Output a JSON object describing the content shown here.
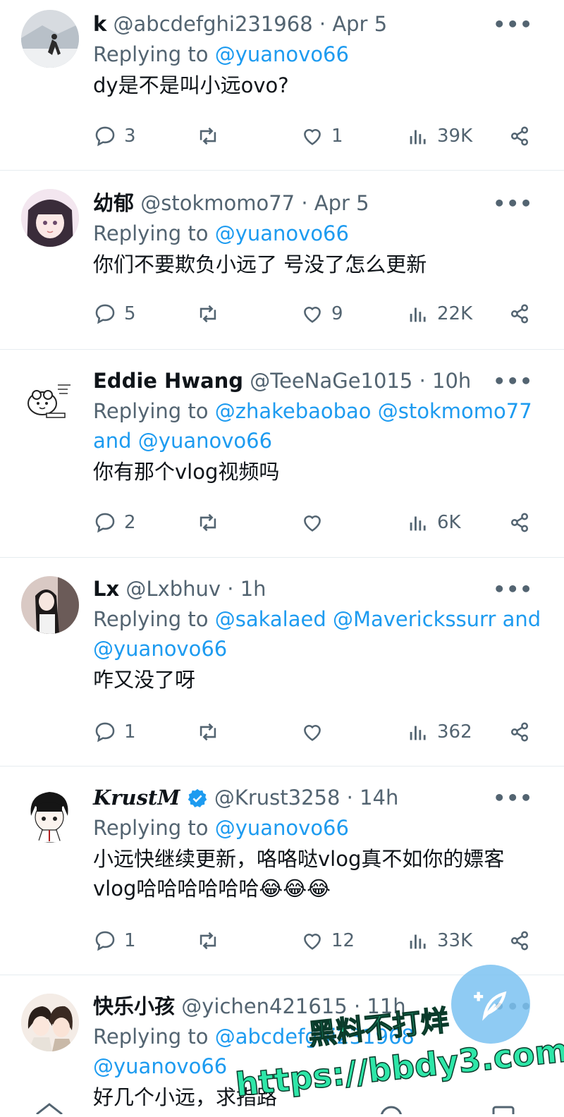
{
  "tweets": [
    {
      "name": "k",
      "handle": "@abcdefghi231968",
      "time": "Apr 5",
      "reply_prefix": "Replying to ",
      "reply_to": "@yuanovo66",
      "text": "dy是不是叫小远ovo?",
      "replies": "3",
      "likes": "1",
      "views": "39K"
    },
    {
      "name": "幼郁",
      "handle": "@stokmomo77",
      "time": "Apr 5",
      "reply_prefix": "Replying to ",
      "reply_to": "@yuanovo66",
      "text": "你们不要欺负小远了 号没了怎么更新",
      "replies": "5",
      "likes": "9",
      "views": "22K"
    },
    {
      "name": "Eddie Hwang",
      "handle": "@TeeNaGe1015",
      "time": "10h",
      "reply_prefix": "Replying to ",
      "reply_to": "@zhakebaobao @stokmomo77",
      "reply_and": "and ",
      "reply_to2": "@yuanovo66",
      "text": "你有那个vlog视频吗",
      "replies": "2",
      "likes": "",
      "views": "6K"
    },
    {
      "name": "Lx",
      "handle": "@Lxbhuv",
      "time": "1h",
      "reply_prefix": "Replying to ",
      "reply_to": "@sakalaed @Maverickssurr",
      "reply_and": " and",
      "reply_to2": "@yuanovo66",
      "text": "咋又没了呀",
      "replies": "1",
      "likes": "",
      "views": "362"
    },
    {
      "name": "KrustM",
      "handle": "@Krust3258",
      "time": "14h",
      "reply_prefix": "Replying to ",
      "reply_to": "@yuanovo66",
      "text": "小远快继续更新，咯咯哒vlog真不如你的嫖客vlog哈哈哈哈哈哈😂😂😂",
      "replies": "1",
      "likes": "12",
      "views": "33K"
    },
    {
      "name": "快乐小孩",
      "handle": "@yichen421615",
      "time": "11h",
      "reply_prefix": "Replying to ",
      "reply_to": "@abcdefghi231968",
      "reply_to2": "@yuanovo66",
      "text": "好几个小远，求指路"
    }
  ],
  "more_label": "•••",
  "watermark": {
    "line1": "黑料不打烊",
    "line2": "https://bbdy3.com"
  },
  "colors": {
    "link": "#1d9bf0",
    "muted": "#536471",
    "verified": "#1d9bf0",
    "watermark": "#2ee6a8"
  }
}
